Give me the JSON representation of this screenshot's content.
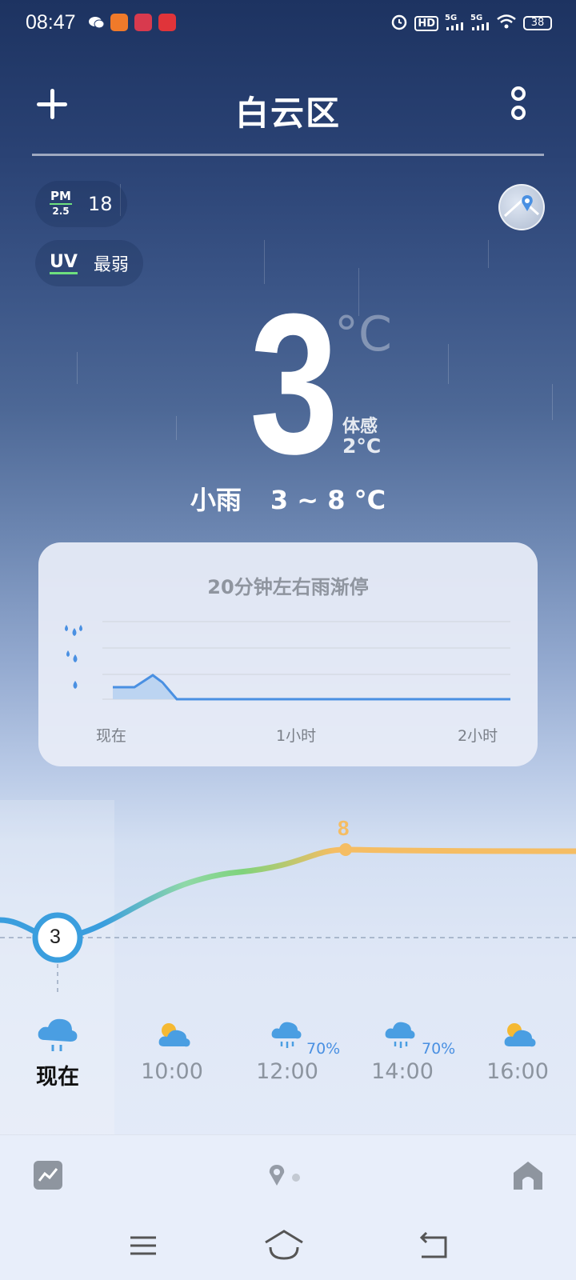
{
  "status_bar": {
    "time": "08:47",
    "battery": "38",
    "network_1": "5G",
    "network_2": "5G",
    "hd_label": "HD"
  },
  "header": {
    "city": "白云区",
    "add_icon": "plus-icon",
    "more_icon": "more-vertical-icon"
  },
  "air": {
    "pm_top": "PM",
    "pm_bottom": "2.5",
    "pm_value": "18",
    "uv_label": "UV",
    "uv_value": "最弱"
  },
  "current": {
    "temperature": "3",
    "unit": "°C",
    "feels_like_label": "体感",
    "feels_like_value": "2°C",
    "condition": "小雨",
    "range": "3 ~ 8 °C"
  },
  "precipitation": {
    "title": "20分钟左右雨渐停",
    "ticks": [
      "现在",
      "1小时",
      "2小时"
    ],
    "levels": [
      "heavy-rain-icon",
      "moderate-rain-icon",
      "light-rain-icon"
    ]
  },
  "hourly": {
    "high_label": "8",
    "current_label": "3",
    "items": [
      {
        "time": "现在",
        "icon": "rain-cloud-icon",
        "pop": ""
      },
      {
        "time": "10:00",
        "icon": "partly-cloudy-icon",
        "pop": ""
      },
      {
        "time": "12:00",
        "icon": "rain-cloud-icon",
        "pop": "70%"
      },
      {
        "time": "14:00",
        "icon": "rain-cloud-icon",
        "pop": "70%"
      },
      {
        "time": "16:00",
        "icon": "partly-cloudy-icon",
        "pop": ""
      }
    ]
  },
  "colors": {
    "accent": "#3a9ede",
    "warm": "#f5bd63",
    "green": "#7fd37c",
    "rain": "#4a90e2"
  }
}
